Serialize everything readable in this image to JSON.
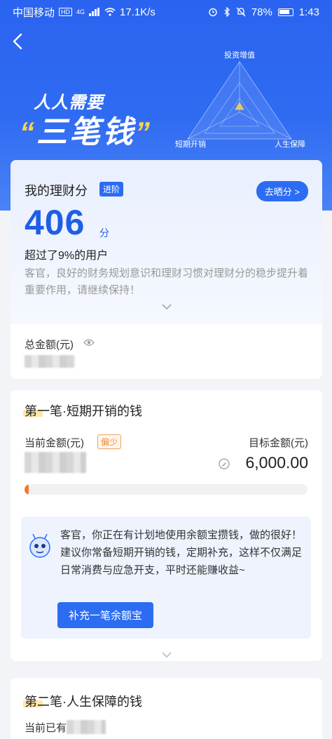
{
  "status_bar": {
    "carrier": "中国移动",
    "hd": "HD",
    "signal_type": "4G",
    "net_speed": "17.1K/s",
    "battery_pct": "78%",
    "time": "1:43"
  },
  "hero": {
    "slogan_line1": "人人需要",
    "slogan_quote_open": "“",
    "slogan_main": "三笔钱",
    "slogan_quote_close": "”",
    "radar_labels": {
      "top": "投资增值",
      "left": "短期开销",
      "right": "人生保障"
    }
  },
  "score_card": {
    "title": "我的理财分",
    "badge": "进阶",
    "share_button": "去晒分 >",
    "score": "406",
    "score_unit": "分",
    "percentile_text": "超过了9%的用户",
    "advice": "客官，良好的财务规划意识和理财习惯对理财分的稳步提升着重要作用，请继续保持！",
    "total_label": "总金额(元)"
  },
  "section1": {
    "title": "第一笔·短期开销的钱",
    "current_label": "当前金额(元)",
    "status_tag": "偏少",
    "target_label": "目标金额(元)",
    "target_value": "6,000.00",
    "progress_fraction": 0.01,
    "tip_text": "客官，你正在有计划地使用余额宝攒钱，做的很好！建议你常备短期开销的钱，定期补充，这样不仅满足日常消费与应急开支，平时还能赚收益~",
    "tip_button": "补充一笔余额宝"
  },
  "section2": {
    "title": "第二笔·人生保障的钱",
    "current_label_partial": "当前已有"
  },
  "colors": {
    "primary": "#2c6cf2",
    "accent_orange": "#f07a2a",
    "highlight_yellow": "#ffd24a"
  }
}
